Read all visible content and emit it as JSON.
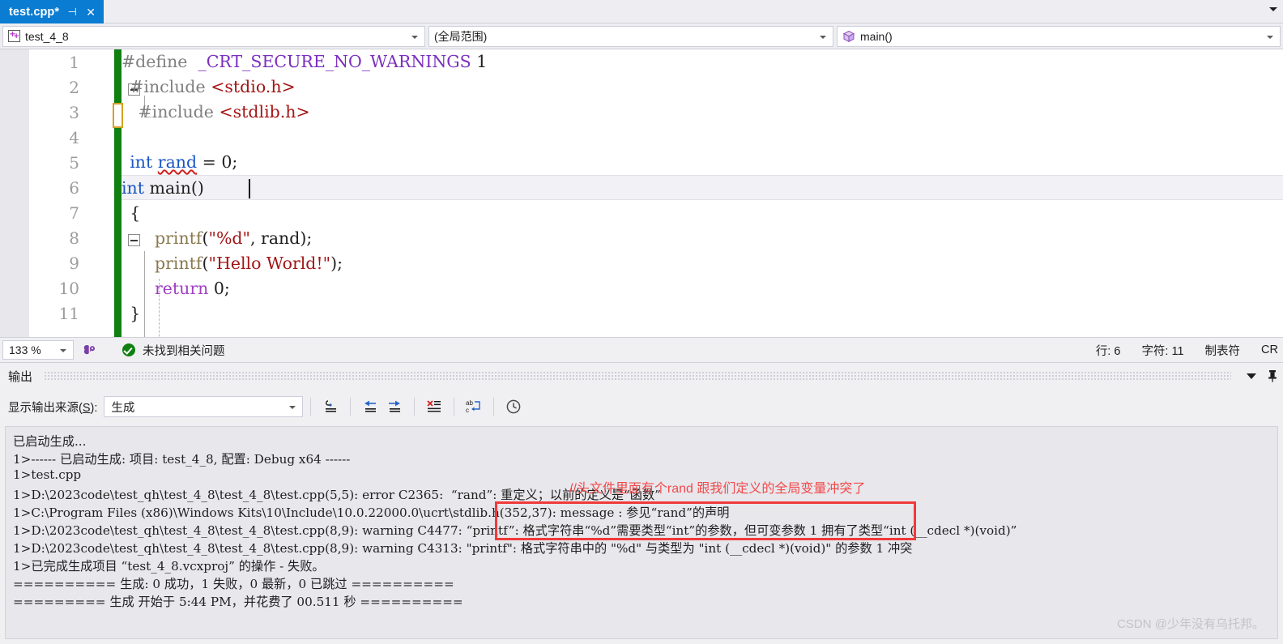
{
  "window": {
    "tab": {
      "title": "test.cpp*",
      "pin_icon": "pin-icon",
      "close_icon": "close-icon"
    },
    "tabstrip_overflow_icon": "chevron-down-icon"
  },
  "navbar": {
    "project": {
      "icon": "project-icon",
      "label": "test_4_8",
      "caret": "chevron-down-icon"
    },
    "scope": {
      "label": "(全局范围)",
      "caret": "chevron-down-icon"
    },
    "member": {
      "icon": "method-cube-icon",
      "label": "main()",
      "caret": "chevron-down-icon"
    }
  },
  "editor": {
    "line_numbers": [
      "1",
      "2",
      "3",
      "4",
      "5",
      "6",
      "7",
      "8",
      "9",
      "10",
      "11"
    ],
    "lines": [
      {
        "n": 1,
        "tokens": [
          {
            "t": "#define ",
            "c": "pp"
          },
          {
            "t": " _CRT_SECURE_NO_WARNINGS",
            "c": "macro"
          },
          {
            "t": " 1",
            "c": "num"
          }
        ]
      },
      {
        "n": 2,
        "tokens": [
          {
            "t": "#include ",
            "c": "pp"
          },
          {
            "t": "<stdio.h>",
            "c": "str"
          }
        ]
      },
      {
        "n": 3,
        "tokens": [
          {
            "t": "#include ",
            "c": "pp"
          },
          {
            "t": "<stdlib.h>",
            "c": "str"
          }
        ]
      },
      {
        "n": 4,
        "tokens": []
      },
      {
        "n": 5,
        "tokens": [
          {
            "t": "int",
            "c": "kw"
          },
          {
            "t": " rand = 0;",
            "c": "plain"
          }
        ]
      },
      {
        "n": 6,
        "tokens": [
          {
            "t": "int",
            "c": "kw"
          },
          {
            "t": " main()",
            "c": "plain"
          }
        ]
      },
      {
        "n": 7,
        "tokens": [
          {
            "t": "{",
            "c": "plain"
          }
        ]
      },
      {
        "n": 8,
        "tokens": [
          {
            "t": "printf",
            "c": "fn"
          },
          {
            "t": "(",
            "c": "plain"
          },
          {
            "t": "\"%d\"",
            "c": "str"
          },
          {
            "t": ", rand);",
            "c": "plain"
          }
        ]
      },
      {
        "n": 9,
        "tokens": [
          {
            "t": "printf",
            "c": "fn"
          },
          {
            "t": "(",
            "c": "plain"
          },
          {
            "t": "\"Hello World!\"",
            "c": "str"
          },
          {
            "t": ");",
            "c": "plain"
          }
        ]
      },
      {
        "n": 10,
        "tokens": [
          {
            "t": "return",
            "c": "ctl"
          },
          {
            "t": " 0;",
            "c": "plain"
          }
        ]
      },
      {
        "n": 11,
        "tokens": [
          {
            "t": "}",
            "c": "plain"
          }
        ]
      }
    ],
    "fold_markers": [
      "line-2-collapse",
      "line-6-collapse"
    ],
    "change_bar_color": "#108010",
    "edit_marker_color": "#d7a022"
  },
  "editor_status": {
    "zoom": "133 %",
    "zoom_caret": "chevron-down-icon",
    "intellisense_icon": "intellisense-icon",
    "health_icon": "check-circle-icon",
    "health_text": "未找到相关问题",
    "line_label": "行: 6",
    "char_label": "字符: 11",
    "tab_label": "制表符",
    "eol_label": "CR"
  },
  "output_panel": {
    "title": "输出",
    "collapse_icon": "chevron-down-icon",
    "pin_icon": "pin-icon",
    "source_label_pre": "显示输出来源(",
    "source_label_key": "S",
    "source_label_post": "):",
    "source_value": "生成",
    "source_caret": "chevron-down-icon",
    "toolbar_icons": [
      "jump-to-line-icon",
      "navigate-back-icon",
      "navigate-forward-icon",
      "clear-all-icon",
      "toggle-word-wrap-icon",
      "show-history-icon"
    ],
    "log_lines": [
      "已启动生成...",
      "1>------ 已启动生成: 项目: test_4_8, 配置: Debug x64 ------",
      "1>test.cpp",
      "1>D:\\2023code\\test_qh\\test_4_8\\test_4_8\\test.cpp(5,5): error C2365:  “rand”: 重定义；以前的定义是“函数”",
      "1>C:\\Program Files (x86)\\Windows Kits\\10\\Include\\10.0.22000.0\\ucrt\\stdlib.h(352,37): message : 参见“rand”的声明",
      "1>D:\\2023code\\test_qh\\test_4_8\\test_4_8\\test.cpp(8,9): warning C4477: “printf”: 格式字符串“%d”需要类型“int”的参数，但可变参数 1 拥有了类型“int (__cdecl *)(void)”",
      "1>D:\\2023code\\test_qh\\test_4_8\\test_4_8\\test.cpp(8,9): warning C4313: \"printf\": 格式字符串中的 \"%d\" 与类型为 \"int (__cdecl *)(void)\" 的参数 1 冲突",
      "1>已完成生成项目 “test_4_8.vcxproj” 的操作 - 失败。",
      "========== 生成: 0 成功，1 失败，0 最新，0 已跳过 ==========",
      "========= 生成 开始于 5:44 PM，并花费了 00.511 秒 =========="
    ],
    "annotation": "//头文件里面有个rand 跟我们定义的全局变量冲突了",
    "annotation_color": "#f24a4a",
    "highlight_box_color": "#f03a3a",
    "watermark": "CSDN @少年没有乌托邦。"
  }
}
